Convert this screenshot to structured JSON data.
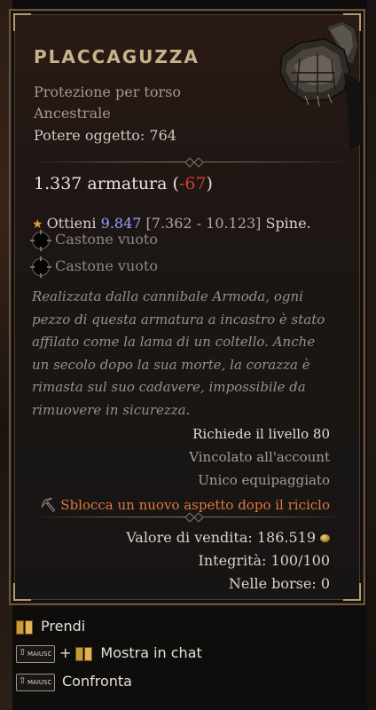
{
  "item": {
    "name": "PLACCAGUZZA",
    "type_line_1": "Protezione per torso",
    "type_line_2": "Ancestrale",
    "power": "Potere oggetto: 764",
    "armor_value": "1.337 armatura",
    "armor_open": " (",
    "armor_diff": "-67",
    "armor_close": ")",
    "affix": {
      "prefix": "Ottieni ",
      "value": "9.847",
      "range": " [7.362 - 10.123]",
      "suffix": " Spine."
    },
    "sockets": [
      "Castone vuoto",
      "Castone vuoto"
    ],
    "flavor": "Realizzata dalla cannibale Armoda, ogni pezzo di questa armatura a incastro è stato affilato come la lama di un coltello. Anche un secolo dopo la sua morte, la corazza è rimasta sul suo cadavere, impossibile da rimuovere in sicurezza.",
    "requires_level": "Richiede il livello 80",
    "account_bound": "Vincolato all'account",
    "unique_equipped": "Unico equipaggiato",
    "unlock_aspect": "Sblocca un nuovo aspetto dopo il riciclo",
    "sell_value": "Valore di vendita: 186.519",
    "durability": "Integrità: 100/100",
    "in_bags": "Nelle borse: 0"
  },
  "hints": {
    "take": "Prendi",
    "key_label": "MAIUSC",
    "plus": "+",
    "show_in_chat": "Mostra in chat",
    "compare": "Confronta"
  },
  "colors": {
    "title": "#c8b28a",
    "negative": "#d23a2e",
    "affix_value": "#9aa0ff",
    "unlock": "#e0783a",
    "border": "#6a5544"
  },
  "icons": [
    "armor-item-icon",
    "star-icon",
    "socket-icon",
    "pickaxe-icon",
    "gold-coin-icon",
    "mouse-book-icon",
    "shift-key-icon"
  ]
}
